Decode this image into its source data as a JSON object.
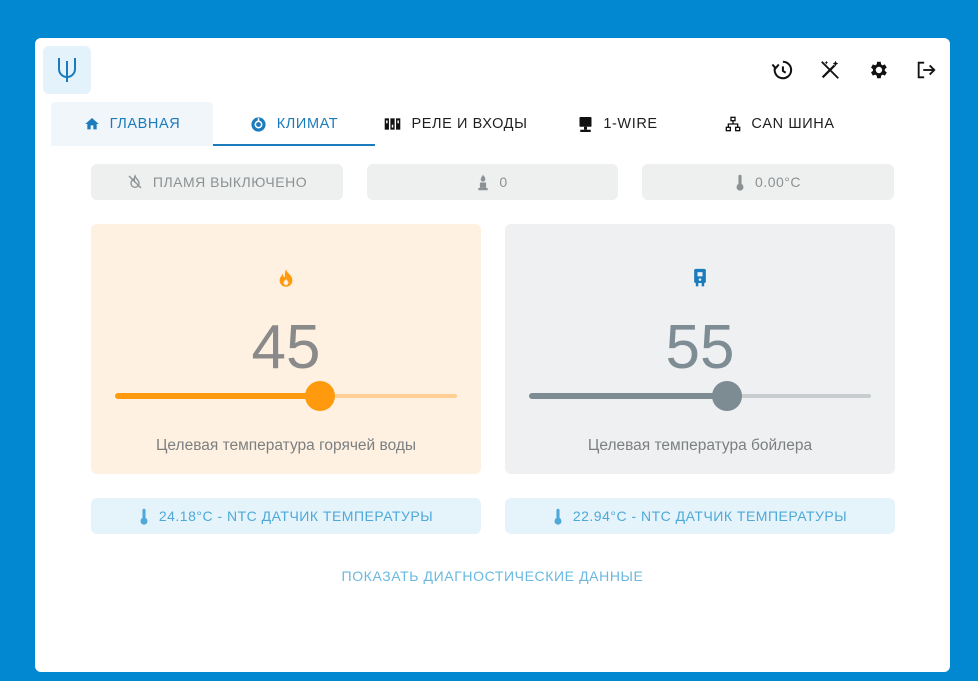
{
  "colors": {
    "accent": "#1a7bbd",
    "hot": "#ff9a0e",
    "boiler": "#7d8b93",
    "background": "#0288d1"
  },
  "header": {
    "logo_icon": "u-logo-icon",
    "actions": [
      {
        "name": "history-icon"
      },
      {
        "name": "magic-off-icon"
      },
      {
        "name": "gear-icon"
      },
      {
        "name": "logout-icon"
      }
    ]
  },
  "tabs": [
    {
      "label": "ГЛАВНАЯ",
      "icon": "home-icon"
    },
    {
      "label": "КЛИМАТ",
      "icon": "climate-icon"
    },
    {
      "label": "РЕЛЕ И ВХОДЫ",
      "icon": "relay-icon"
    },
    {
      "label": "1-WIRE",
      "icon": "monitor-icon"
    },
    {
      "label": "CAN ШИНА",
      "icon": "network-icon"
    }
  ],
  "status": {
    "flame": "ПЛАМЯ ВЫКЛЮЧЕНО",
    "modulation": "0",
    "temperature": "0.00°C"
  },
  "hot_water": {
    "icon": "fire-icon",
    "value": "45",
    "level": 0.6,
    "caption": "Целевая температура горячей воды",
    "sensor": "24.18°C - NTC ДАТЧИК ТЕМПЕРАТУРЫ"
  },
  "boiler": {
    "icon": "boiler-icon",
    "value": "55",
    "level": 0.58,
    "caption": "Целевая температура бойлера",
    "sensor": "22.94°C - NTC ДАТЧИК ТЕМПЕРАТУРЫ"
  },
  "diagnostics_link": "ПОКАЗАТЬ ДИАГНОСТИЧЕСКИЕ ДАННЫЕ"
}
